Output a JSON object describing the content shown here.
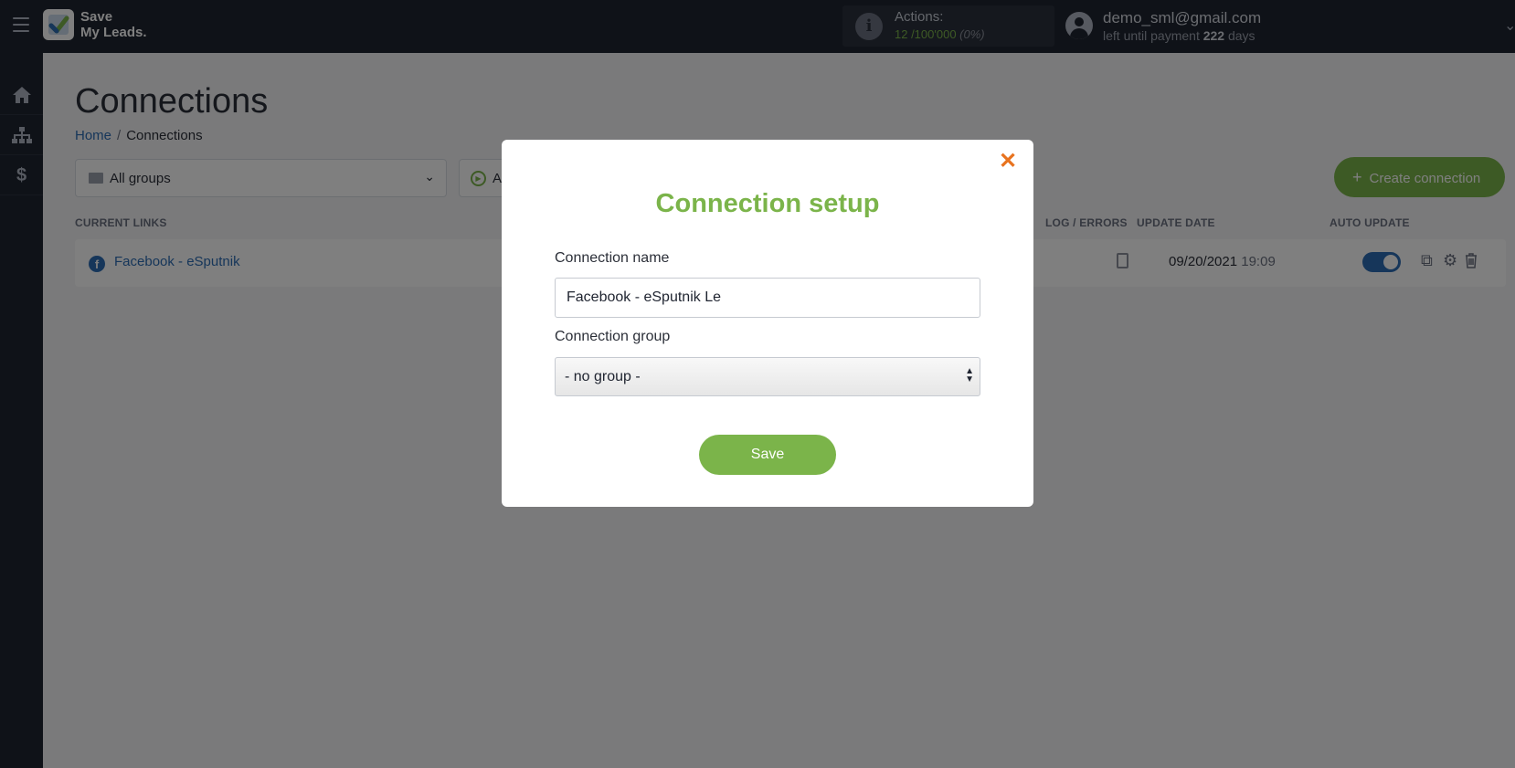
{
  "header": {
    "logo_line1": "Save",
    "logo_line2": "My Leads.",
    "actions_label": "Actions:",
    "actions_value": "12 /100'000",
    "actions_percent": "(0%)",
    "user_email": "demo_sml@gmail.com",
    "payment_prefix": "left until payment",
    "payment_days": "222",
    "payment_suffix": "days"
  },
  "sidebar": {
    "items": [
      {
        "name": "home-icon"
      },
      {
        "name": "sitemap-icon"
      },
      {
        "name": "dollar-icon"
      }
    ]
  },
  "page": {
    "title": "Connections",
    "breadcrumb_home": "Home",
    "breadcrumb_sep": "/",
    "breadcrumb_current": "Connections",
    "filter_groups": "All groups",
    "filter_status": "All",
    "create_button": "Create connection"
  },
  "table": {
    "headers": {
      "current_links": "CURRENT LINKS",
      "log_errors": "LOG / ERRORS",
      "update_date": "UPDATE DATE",
      "auto_update": "AUTO UPDATE"
    },
    "rows": [
      {
        "name": "Facebook - eSputnik",
        "date": "09/20/2021",
        "time": "19:09",
        "auto_update": true
      }
    ]
  },
  "modal": {
    "title": "Connection setup",
    "name_label": "Connection name",
    "name_value": "Facebook - eSputnik Le",
    "group_label": "Connection group",
    "group_value": "- no group -",
    "save_label": "Save"
  },
  "colors": {
    "brand_green": "#7bb44a",
    "close_orange": "#e8731f",
    "link_blue": "#2d6db4",
    "topbar": "#1f2430"
  }
}
